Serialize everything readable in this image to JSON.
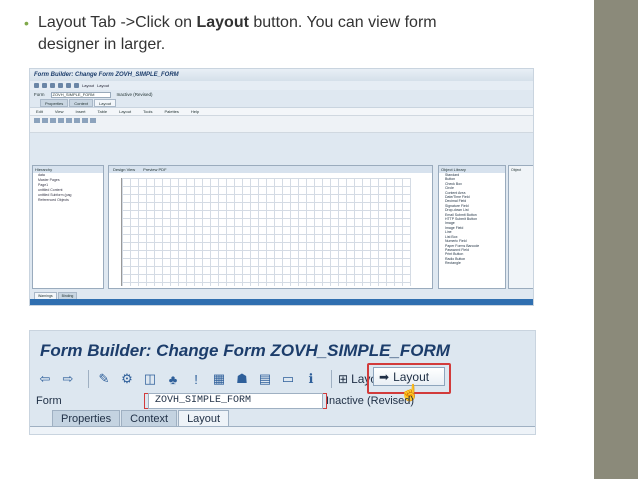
{
  "slide": {
    "bullet_prefix": "Layout Tab ->Click on ",
    "bullet_bold": "Layout",
    "bullet_suffix": " button. You can view form",
    "bullet_line2": "designer in larger."
  },
  "overview": {
    "title": "Form Builder: Change Form ZOVH_SIMPLE_FORM",
    "toolbar_layout": "Layout",
    "toolbar_layout2": "Layout",
    "form_label": "Form",
    "form_value": "ZOVH_SIMPLE_FORM",
    "form_status": "Inactive (Revised)",
    "tabs": [
      "Properties",
      "Context",
      "Layout"
    ],
    "menu": [
      "Edit",
      "View",
      "Insert",
      "Table",
      "Layout",
      "Tools",
      "Palettes",
      "Help"
    ],
    "hierarchy_title": "Hierarchy",
    "hierarchy_items": [
      "data",
      "Master Pages",
      "Page1",
      "untitled Content",
      "untitled Subform (pag",
      "Referenced Objects"
    ],
    "design_tabs": [
      "Design View",
      "Preview PDF"
    ],
    "library_title": "Object Library",
    "library_group": "Standard",
    "library_items": [
      "Button",
      "Check Box",
      "Circle",
      "Content Area",
      "Date/Time Field",
      "Decimal Field",
      "Signature Field",
      "Drop-down List",
      "Email Submit Button",
      "HTTP Submit Button",
      "Image",
      "Image Field",
      "Line",
      "List Box",
      "Numeric Field",
      "Paper Forms Barcode",
      "Password Field",
      "Print Button",
      "Radio Button",
      "Rectangle"
    ],
    "object_title": "Object",
    "bottom_tabs": [
      "Warnings",
      "Binding"
    ]
  },
  "zoomed": {
    "title": "Form Builder: Change Form ZOVH_SIMPLE_FORM",
    "toolbar_layout_text": "Layout",
    "layout_button": "Layout",
    "form_label": "Form",
    "form_value": "ZOVH_SIMPLE_FORM",
    "form_status": "Inactive (Revised)",
    "tabs": [
      "Properties",
      "Context",
      "Layout"
    ]
  },
  "colors": {
    "highlight": "#d23b3b",
    "title_blue": "#1c3d6b",
    "side_panel": "#8b8a7a"
  }
}
